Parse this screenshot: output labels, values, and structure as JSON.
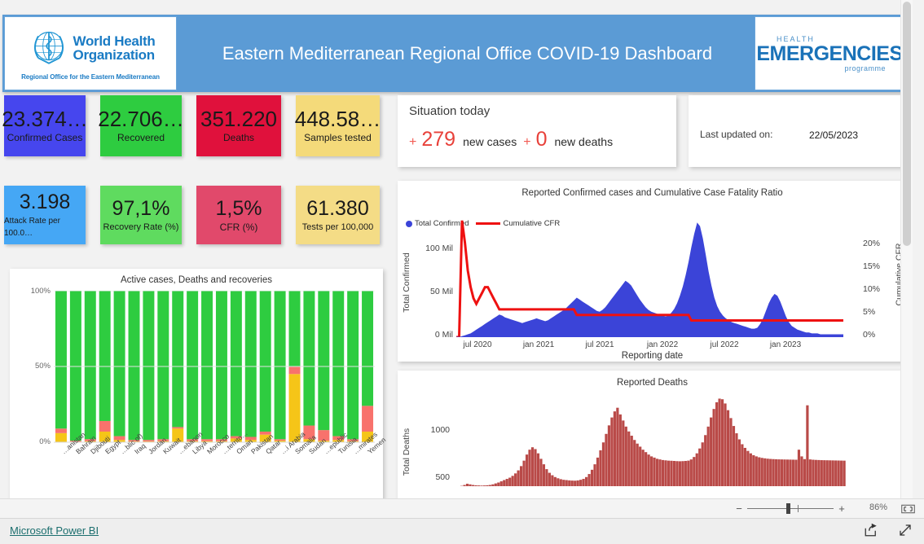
{
  "header": {
    "title": "Eastern Mediterranean Regional Office COVID-19 Dashboard",
    "who_name_line1": "World Health",
    "who_name_line2": "Organization",
    "who_subtitle": "Regional Office for the Eastern Mediterranean",
    "emergencies_health": "HEALTH",
    "emergencies_main": "EMERGENCIES",
    "emergencies_programme": "programme",
    "bg_color": "#5b9bd5"
  },
  "kpis": [
    {
      "value": "23.374…",
      "label": "Confirmed Cases",
      "color": "#4646ee",
      "text_color": "#111111"
    },
    {
      "value": "22.706…",
      "label": "Recovered",
      "color": "#2ecc40",
      "text_color": "#111111"
    },
    {
      "value": "351.220",
      "label": "Deaths",
      "color": "#e0113c",
      "text_color": "#111111"
    },
    {
      "value": "448.58…",
      "label": "Samples tested",
      "color": "#f4da7a",
      "text_color": "#111111"
    },
    {
      "value": "3.198",
      "label": "Attack Rate per 100.0…",
      "color": "#45a7f5",
      "text_color": "#111111"
    },
    {
      "value": "97,1%",
      "label": "Recovery Rate (%)",
      "color": "#5fdb5f",
      "text_color": "#111111"
    },
    {
      "value": "1,5%",
      "label": "CFR (%)",
      "color": "#e1496b",
      "text_color": "#111111"
    },
    {
      "value": "61.380",
      "label": "Tests per 100,000",
      "color": "#f4dc86",
      "text_color": "#111111"
    }
  ],
  "situation": {
    "title": "Situation today",
    "plus1": "+",
    "new_cases_value": "279",
    "new_cases_label": "new cases",
    "plus2": "+",
    "new_deaths_value": "0",
    "new_deaths_label": "new deaths"
  },
  "last_updated": {
    "label": "Last updated on:",
    "value": "22/05/2023"
  },
  "status_bar": {
    "zoom_minus": "−",
    "zoom_plus": "+",
    "zoom_percent": "86%"
  },
  "footer": {
    "link": "Microsoft Power BI"
  },
  "chart_data": [
    {
      "type": "area",
      "name": "confirmed-cfr-chart",
      "title": "Reported Confirmed cases and Cumulative Case Fatality Ratio",
      "xlabel": "Reporting date",
      "ylabel": "Total Confirmed",
      "y2label": "Cumulative CFR",
      "legend": [
        {
          "label": "Total Confirmed",
          "color": "#3b44d8",
          "marker": "dot"
        },
        {
          "label": "Cumulative CFR",
          "color": "#ee1111",
          "marker": "line"
        }
      ],
      "legend_position": "top-left",
      "grid": false,
      "xticks": [
        "jul 2020",
        "jan 2021",
        "jul 2021",
        "jan 2022",
        "jul 2022",
        "jan 2023"
      ],
      "yticks": [
        "0 Mil",
        "50 Mil",
        "100 Mil"
      ],
      "ylim": [
        0,
        130
      ],
      "y2ticks": [
        "0%",
        "5%",
        "10%",
        "15%",
        "20%"
      ],
      "y2lim": [
        0,
        22
      ],
      "series": [
        {
          "name": "Total Confirmed",
          "color": "#3b44d8",
          "values": [
            0,
            0,
            1,
            2,
            3,
            4,
            6,
            8,
            10,
            12,
            14,
            16,
            18,
            20,
            22,
            24,
            23,
            21,
            20,
            19,
            18,
            17,
            16,
            15,
            16,
            17,
            18,
            19,
            20,
            19,
            18,
            17,
            18,
            20,
            22,
            24,
            26,
            28,
            30,
            33,
            36,
            39,
            42,
            40,
            38,
            36,
            34,
            32,
            30,
            28,
            27,
            29,
            32,
            36,
            40,
            44,
            48,
            52,
            56,
            60,
            58,
            55,
            50,
            45,
            40,
            36,
            32,
            29,
            27,
            26,
            25,
            24,
            23,
            22,
            23,
            26,
            30,
            36,
            44,
            54,
            66,
            80,
            96,
            110,
            122,
            118,
            105,
            88,
            70,
            55,
            42,
            33,
            27,
            23,
            20,
            18,
            16,
            15,
            14,
            13,
            12,
            11,
            10,
            9,
            9,
            10,
            14,
            20,
            28,
            36,
            42,
            46,
            44,
            38,
            30,
            22,
            16,
            12,
            10,
            8,
            7,
            6,
            5,
            5,
            4,
            4,
            4,
            3,
            3,
            3,
            3,
            3,
            3,
            3,
            3,
            3
          ]
        },
        {
          "name": "Cumulative CFR",
          "color": "#ee1111",
          "values": [
            0,
            0,
            21,
            17,
            12,
            9,
            7,
            6,
            7,
            8,
            9,
            9,
            8,
            7,
            6,
            5,
            5,
            5,
            5,
            5,
            5,
            5,
            5,
            5,
            5,
            5,
            5,
            5,
            5,
            5,
            5,
            5,
            5,
            5,
            5,
            5,
            5,
            5,
            5,
            5,
            5,
            5,
            4,
            4,
            4,
            4,
            4,
            4,
            4,
            4,
            4,
            4,
            4,
            4,
            4,
            4,
            4,
            4,
            4,
            4,
            4,
            4,
            4,
            4,
            4,
            4,
            4,
            4,
            4,
            4,
            4,
            4,
            4,
            4,
            4,
            4,
            4,
            4,
            4,
            4,
            4,
            4,
            3,
            3,
            3,
            3,
            3,
            3,
            3,
            3,
            3,
            3,
            3,
            3,
            3,
            3,
            3,
            3,
            3,
            3,
            3,
            3,
            3,
            3,
            3,
            3,
            3,
            3,
            3,
            3,
            3,
            3,
            3,
            3,
            3,
            3,
            3,
            3,
            3,
            3,
            3,
            3,
            3,
            3,
            3,
            3,
            3,
            3,
            3,
            3,
            3,
            3,
            3,
            3,
            3,
            3
          ]
        }
      ]
    },
    {
      "type": "bar",
      "name": "reported-deaths-chart",
      "title": "Reported Deaths",
      "ylabel": "Total Deaths",
      "yticks": [
        "500",
        "1000"
      ],
      "ylim": [
        0,
        1500
      ],
      "grid": false,
      "color": "#b94a48",
      "values": [
        0,
        0,
        5,
        20,
        40,
        30,
        20,
        15,
        12,
        10,
        12,
        15,
        20,
        30,
        45,
        60,
        80,
        100,
        120,
        140,
        170,
        210,
        260,
        330,
        420,
        520,
        600,
        640,
        610,
        540,
        450,
        360,
        280,
        220,
        180,
        150,
        130,
        115,
        105,
        100,
        95,
        92,
        90,
        95,
        105,
        120,
        150,
        200,
        270,
        360,
        470,
        590,
        720,
        860,
        1000,
        1130,
        1230,
        1290,
        1180,
        1080,
        980,
        900,
        830,
        760,
        700,
        650,
        600,
        560,
        520,
        490,
        470,
        450,
        440,
        430,
        425,
        420,
        418,
        415,
        412,
        410,
        412,
        415,
        420,
        440,
        480,
        540,
        620,
        720,
        840,
        980,
        1130,
        1270,
        1380,
        1440,
        1430,
        1360,
        1250,
        1120,
        990,
        870,
        770,
        690,
        630,
        580,
        540,
        510,
        490,
        475,
        465,
        458,
        452,
        448,
        445,
        443,
        441,
        440,
        439,
        438,
        437,
        436,
        435,
        600,
        490,
        445,
        1330,
        440,
        435,
        432,
        430,
        428,
        427,
        426,
        425,
        424,
        423,
        422,
        421,
        420
      ]
    },
    {
      "type": "bar",
      "name": "active-deaths-recoveries-chart",
      "title": "Active cases, Deaths  and recoveries",
      "stacked": true,
      "yticks": [
        "0%",
        "50%",
        "100%"
      ],
      "ylim": [
        0,
        100
      ],
      "grid": false,
      "legend_position": "none",
      "series": [
        {
          "name": "Recovered",
          "color": "#2ecc40",
          "values": [
            91,
            99,
            98,
            86,
            96,
            98.5,
            98.5,
            98,
            90,
            98,
            98,
            98,
            96,
            96.5,
            93,
            98,
            50,
            89,
            92,
            96,
            98,
            76
          ]
        },
        {
          "name": "Deaths",
          "color": "#f8726c",
          "values": [
            3,
            0.6,
            1.3,
            7,
            2.5,
            1,
            1,
            1.3,
            1,
            1.3,
            1.3,
            1.3,
            1.5,
            2,
            2,
            1,
            5,
            9,
            7,
            2.5,
            1.3,
            17
          ]
        },
        {
          "name": "Active",
          "color": "#f5c518",
          "values": [
            6,
            0.4,
            0.7,
            7,
            1.5,
            0.5,
            0.5,
            0.7,
            9,
            0.7,
            0.7,
            0.7,
            2.5,
            1.5,
            5,
            1,
            45,
            2,
            1,
            1.5,
            0.7,
            7
          ]
        }
      ],
      "categories": [
        "Afghanistan",
        "Bahrain",
        "Djibouti",
        "Egypt",
        "Iran (Islamic Republic of)",
        "Iraq",
        "Jordan",
        "Kuwait",
        "Lebanon",
        "Libya",
        "Morocco",
        "occupied Palestinian territo…",
        "Oman",
        "Pakistan",
        "Qatar",
        "Saudi Arabia",
        "Somalia",
        "Sudan",
        "Syrian Arab Republic",
        "Tunisia",
        "United Arab Emirates",
        "Yemen"
      ],
      "categories_display": [
        "…anistan",
        "Bahrain",
        "Djibouti",
        "Egypt",
        "…blic of)",
        "Iraq",
        "Jordan",
        "Kuwait",
        "…ebanon",
        "Libya",
        "Morocco",
        "…territo…",
        "Oman",
        "Pakistan",
        "Qatar",
        "…i Arabia",
        "Somalia",
        "Sudan",
        "…epublic",
        "Tunisia",
        "…mirates",
        "Yemen"
      ]
    }
  ]
}
